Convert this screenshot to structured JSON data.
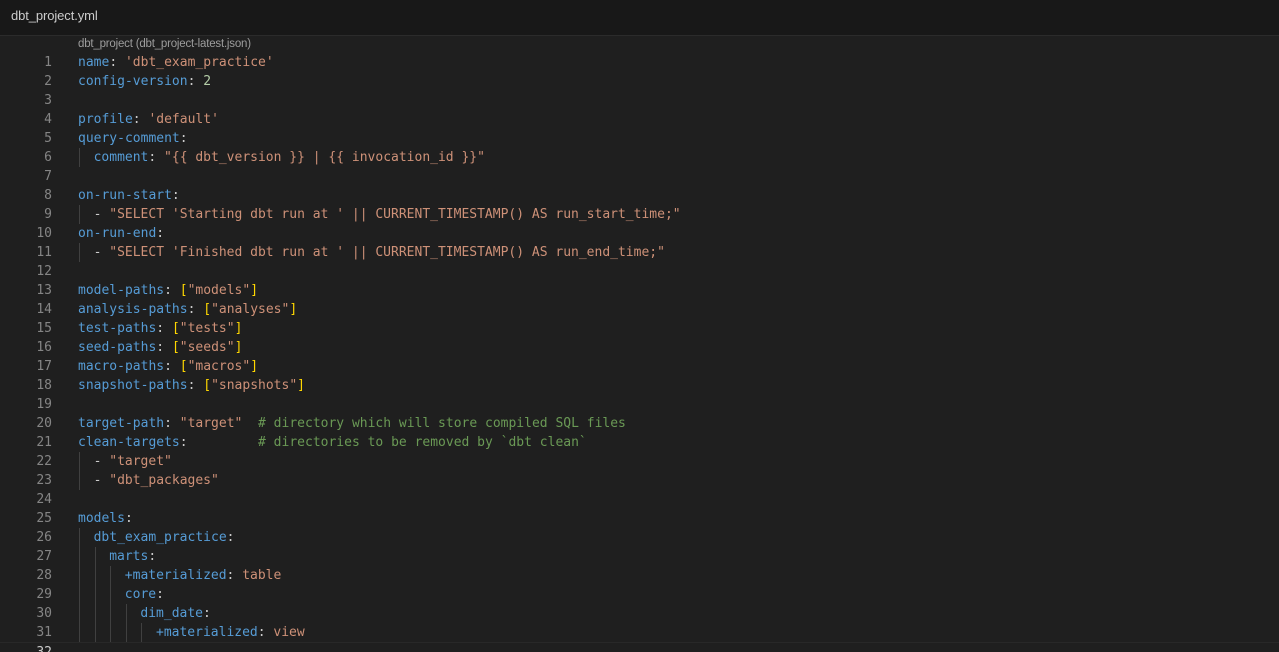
{
  "tab": {
    "title": "dbt_project.yml"
  },
  "schema_hint": "dbt_project (dbt_project-latest.json)",
  "colors": {
    "background": "#1f1f1f",
    "key": "#569cd6",
    "string": "#ce9178",
    "number": "#b5cea8",
    "comment": "#6a9955",
    "bracket": "#ffd700"
  },
  "lines": [
    {
      "n": "1",
      "indent": 0,
      "tokens": [
        [
          "key",
          "name"
        ],
        [
          "pun",
          ": "
        ],
        [
          "str",
          "'dbt_exam_practice'"
        ]
      ]
    },
    {
      "n": "2",
      "indent": 0,
      "tokens": [
        [
          "key",
          "config-version"
        ],
        [
          "pun",
          ": "
        ],
        [
          "num",
          "2"
        ]
      ]
    },
    {
      "n": "3",
      "indent": 0,
      "tokens": []
    },
    {
      "n": "4",
      "indent": 0,
      "tokens": [
        [
          "key",
          "profile"
        ],
        [
          "pun",
          ": "
        ],
        [
          "str",
          "'default'"
        ]
      ]
    },
    {
      "n": "5",
      "indent": 0,
      "tokens": [
        [
          "key",
          "query-comment"
        ],
        [
          "pun",
          ":"
        ]
      ]
    },
    {
      "n": "6",
      "indent": 1,
      "tokens": [
        [
          "key",
          "comment"
        ],
        [
          "pun",
          ": "
        ],
        [
          "str",
          "\"{{ dbt_version }} | {{ invocation_id }}\""
        ]
      ]
    },
    {
      "n": "7",
      "indent": 0,
      "tokens": []
    },
    {
      "n": "8",
      "indent": 0,
      "tokens": [
        [
          "key",
          "on-run-start"
        ],
        [
          "pun",
          ":"
        ]
      ]
    },
    {
      "n": "9",
      "indent": 1,
      "tokens": [
        [
          "pun",
          "- "
        ],
        [
          "str",
          "\"SELECT 'Starting dbt run at ' || CURRENT_TIMESTAMP() AS run_start_time;\""
        ]
      ]
    },
    {
      "n": "10",
      "indent": 0,
      "tokens": [
        [
          "key",
          "on-run-end"
        ],
        [
          "pun",
          ":"
        ]
      ]
    },
    {
      "n": "11",
      "indent": 1,
      "tokens": [
        [
          "pun",
          "- "
        ],
        [
          "str",
          "\"SELECT 'Finished dbt run at ' || CURRENT_TIMESTAMP() AS run_end_time;\""
        ]
      ]
    },
    {
      "n": "12",
      "indent": 0,
      "tokens": []
    },
    {
      "n": "13",
      "indent": 0,
      "tokens": [
        [
          "key",
          "model-paths"
        ],
        [
          "pun",
          ": "
        ],
        [
          "br1",
          "["
        ],
        [
          "str",
          "\"models\""
        ],
        [
          "br1",
          "]"
        ]
      ]
    },
    {
      "n": "14",
      "indent": 0,
      "tokens": [
        [
          "key",
          "analysis-paths"
        ],
        [
          "pun",
          ": "
        ],
        [
          "br1",
          "["
        ],
        [
          "str",
          "\"analyses\""
        ],
        [
          "br1",
          "]"
        ]
      ]
    },
    {
      "n": "15",
      "indent": 0,
      "tokens": [
        [
          "key",
          "test-paths"
        ],
        [
          "pun",
          ": "
        ],
        [
          "br1",
          "["
        ],
        [
          "str",
          "\"tests\""
        ],
        [
          "br1",
          "]"
        ]
      ]
    },
    {
      "n": "16",
      "indent": 0,
      "tokens": [
        [
          "key",
          "seed-paths"
        ],
        [
          "pun",
          ": "
        ],
        [
          "br1",
          "["
        ],
        [
          "str",
          "\"seeds\""
        ],
        [
          "br1",
          "]"
        ]
      ]
    },
    {
      "n": "17",
      "indent": 0,
      "tokens": [
        [
          "key",
          "macro-paths"
        ],
        [
          "pun",
          ": "
        ],
        [
          "br1",
          "["
        ],
        [
          "str",
          "\"macros\""
        ],
        [
          "br1",
          "]"
        ]
      ]
    },
    {
      "n": "18",
      "indent": 0,
      "tokens": [
        [
          "key",
          "snapshot-paths"
        ],
        [
          "pun",
          ": "
        ],
        [
          "br1",
          "["
        ],
        [
          "str",
          "\"snapshots\""
        ],
        [
          "br1",
          "]"
        ]
      ]
    },
    {
      "n": "19",
      "indent": 0,
      "tokens": []
    },
    {
      "n": "20",
      "indent": 0,
      "tokens": [
        [
          "key",
          "target-path"
        ],
        [
          "pun",
          ": "
        ],
        [
          "str",
          "\"target\""
        ],
        [
          "pun",
          "  "
        ],
        [
          "com",
          "# directory which will store compiled SQL files"
        ]
      ]
    },
    {
      "n": "21",
      "indent": 0,
      "tokens": [
        [
          "key",
          "clean-targets"
        ],
        [
          "pun",
          ":         "
        ],
        [
          "com",
          "# directories to be removed by `dbt clean`"
        ]
      ]
    },
    {
      "n": "22",
      "indent": 1,
      "tokens": [
        [
          "pun",
          "- "
        ],
        [
          "str",
          "\"target\""
        ]
      ]
    },
    {
      "n": "23",
      "indent": 1,
      "tokens": [
        [
          "pun",
          "- "
        ],
        [
          "str",
          "\"dbt_packages\""
        ]
      ]
    },
    {
      "n": "24",
      "indent": 0,
      "tokens": []
    },
    {
      "n": "25",
      "indent": 0,
      "tokens": [
        [
          "key",
          "models"
        ],
        [
          "pun",
          ":"
        ]
      ]
    },
    {
      "n": "26",
      "indent": 1,
      "tokens": [
        [
          "key",
          "dbt_exam_practice"
        ],
        [
          "pun",
          ":"
        ]
      ]
    },
    {
      "n": "27",
      "indent": 2,
      "tokens": [
        [
          "key",
          "marts"
        ],
        [
          "pun",
          ":"
        ]
      ]
    },
    {
      "n": "28",
      "indent": 3,
      "tokens": [
        [
          "key",
          "+materialized"
        ],
        [
          "pun",
          ": "
        ],
        [
          "str",
          "table"
        ]
      ]
    },
    {
      "n": "29",
      "indent": 3,
      "tokens": [
        [
          "key",
          "core"
        ],
        [
          "pun",
          ":"
        ]
      ]
    },
    {
      "n": "30",
      "indent": 4,
      "tokens": [
        [
          "key",
          "dim_date"
        ],
        [
          "pun",
          ":"
        ]
      ]
    },
    {
      "n": "31",
      "indent": 5,
      "tokens": [
        [
          "key",
          "+materialized"
        ],
        [
          "pun",
          ": "
        ],
        [
          "str",
          "view"
        ]
      ]
    },
    {
      "n": "32",
      "indent": 0,
      "tokens": []
    }
  ],
  "current_line": "32"
}
